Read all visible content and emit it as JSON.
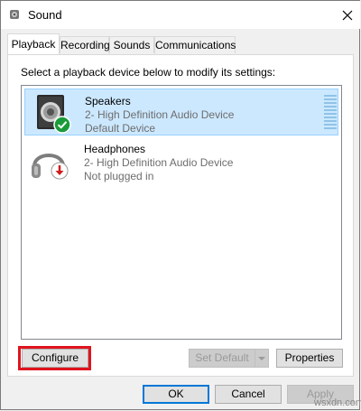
{
  "window": {
    "title": "Sound"
  },
  "tabs": [
    {
      "label": "Playback",
      "active": true
    },
    {
      "label": "Recording",
      "active": false
    },
    {
      "label": "Sounds",
      "active": false
    },
    {
      "label": "Communications",
      "active": false
    }
  ],
  "panel": {
    "instruction": "Select a playback device below to modify its settings:",
    "devices": [
      {
        "name": "Speakers",
        "driver": "2- High Definition Audio Device",
        "status": "Default Device",
        "selected": true,
        "status_icon": "check-icon"
      },
      {
        "name": "Headphones",
        "driver": "2- High Definition Audio Device",
        "status": "Not plugged in",
        "selected": false,
        "status_icon": "down-arrow-icon"
      }
    ]
  },
  "buttons": {
    "configure": "Configure",
    "set_default": "Set Default",
    "properties": "Properties",
    "ok": "OK",
    "cancel": "Cancel",
    "apply": "Apply"
  },
  "watermark": "wsxdn.com",
  "colors": {
    "selection": "#cce8ff",
    "highlight_box": "#e0141e",
    "check_green": "#1a9b3b",
    "arrow_red": "#d01c1c"
  }
}
